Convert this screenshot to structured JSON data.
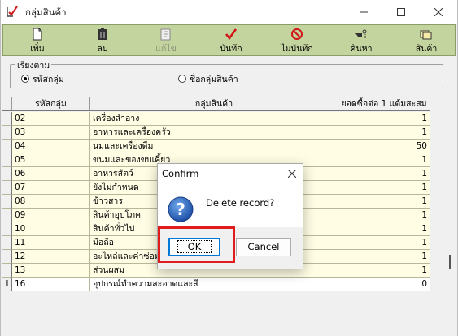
{
  "window": {
    "title": "กลุ่มสินค้า"
  },
  "toolbar": {
    "buttons": [
      {
        "label": "เพิ่ม",
        "icon": "new-document-icon"
      },
      {
        "label": "ลบ",
        "icon": "trash-icon"
      },
      {
        "label": "แก้ไข",
        "icon": "edit-icon",
        "disabled": true
      },
      {
        "label": "บันทึก",
        "icon": "checkmark-icon"
      },
      {
        "label": "ไม่บันทึก",
        "icon": "cancel-icon"
      },
      {
        "label": "ค้นหา",
        "icon": "find-icon"
      },
      {
        "label": "สินค้า",
        "icon": "folders-icon"
      }
    ]
  },
  "sort": {
    "legend": "เรียงตาม",
    "options": [
      {
        "label": "รหัสกลุ่ม",
        "selected": true
      },
      {
        "label": "ชื่อกลุ่มสินค้า",
        "selected": false
      }
    ]
  },
  "grid": {
    "columns": [
      "รหัสกลุ่ม",
      "กลุ่มสินค้า",
      "ยอดซื้อต่อ 1 แต้มสะสม"
    ],
    "rows": [
      [
        "02",
        "เครื่องสำอาง",
        "1"
      ],
      [
        "03",
        "อาหารและเครื่องครัว",
        "1"
      ],
      [
        "04",
        "นมและเครื่องดื่ม",
        "50"
      ],
      [
        "05",
        "ขนมและของขบเคี้ยว",
        "1"
      ],
      [
        "06",
        "อาหารสัตว์",
        "1"
      ],
      [
        "07",
        "ยังไม่กำหนด",
        "1"
      ],
      [
        "08",
        "ข้าวสาร",
        "1"
      ],
      [
        "09",
        "สินค้าอุปโภค",
        "1"
      ],
      [
        "10",
        "สินค้าทั่วไป",
        "1"
      ],
      [
        "11",
        "มือถือ",
        "1"
      ],
      [
        "12",
        "อะไหล่และค่าซ่อม",
        "1"
      ],
      [
        "13",
        "ส่วนผสม",
        "1"
      ],
      [
        "16",
        "อุปกรณ์ทำความสะอาดและสี",
        "0"
      ]
    ],
    "current_row_marker": "I"
  },
  "dialog": {
    "title": "Confirm",
    "message": "Delete record?",
    "ok_label": "OK",
    "cancel_label": "Cancel"
  },
  "colors": {
    "toolbar": "#c4d49f",
    "row_bg": "#fffde3",
    "highlight": "#e01b1b",
    "focus": "#0078d7"
  }
}
